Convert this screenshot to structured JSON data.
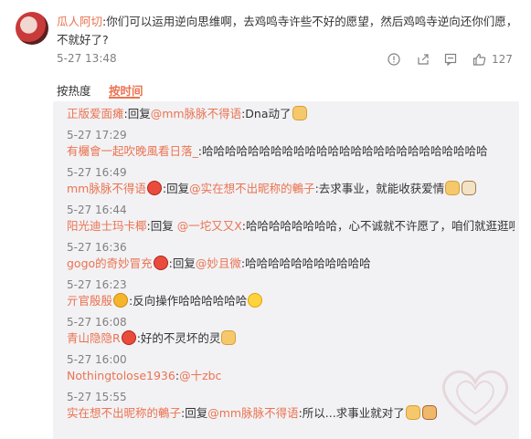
{
  "comment": {
    "username": "瓜人阿切",
    "text": ":你们可以运用逆向思维啊，去鸡鸣寺许些不好的愿望，然后鸡鸣寺逆向还你们愿，不就好了?",
    "time": "5-27 13:48",
    "like_count": "127",
    "icons": [
      "report-icon",
      "share-icon",
      "comment-icon",
      "like-icon"
    ]
  },
  "sort": {
    "hot_label": "按热度",
    "time_label": "按时间",
    "active": "time"
  },
  "replies": [
    {
      "name": "正版爱面瘫",
      "segments": [
        {
          "t": ":回复",
          "c": ""
        },
        {
          "t": "@mm脉脉不得语",
          "c": "mention"
        },
        {
          "t": ":Dna动了",
          "c": ""
        }
      ],
      "emoji_after": [
        "cat"
      ],
      "time": "5-27 17:29"
    },
    {
      "name": "有欘會一起吹晚風看日落_",
      "segments": [
        {
          "t": ":哈哈哈哈哈哈哈哈哈哈哈哈哈哈哈哈哈哈哈哈哈哈哈哈哈",
          "c": ""
        }
      ],
      "emoji_after": [],
      "time": "5-27 16:49"
    },
    {
      "name": "mm脉脉不得语",
      "name_badge": "badge",
      "segments": [
        {
          "t": ":回复",
          "c": ""
        },
        {
          "t": "@实在想不出昵称的鵪子",
          "c": "mention"
        },
        {
          "t": ":去求事业，就能收获爱情",
          "c": ""
        }
      ],
      "emoji_after": [
        "cat",
        "dog"
      ],
      "time": "5-27 16:44"
    },
    {
      "name": "阳光迪士玛卡椰",
      "segments": [
        {
          "t": ":回复 ",
          "c": ""
        },
        {
          "t": "@一坨又又X",
          "c": "mention"
        },
        {
          "t": ":哈哈哈哈哈哈哈哈，心不诚就不许愿了，咱们就逛逛呗",
          "c": ""
        }
      ],
      "emoji_after": [],
      "time": "5-27 16:36"
    },
    {
      "name": "gogo的奇妙冒充",
      "name_badge": "badge",
      "segments": [
        {
          "t": ":回复",
          "c": ""
        },
        {
          "t": "@妙且微",
          "c": "mention"
        },
        {
          "t": ":哈哈哈哈哈哈哈哈哈哈哈",
          "c": ""
        }
      ],
      "emoji_after": [],
      "time": "5-27 16:23"
    },
    {
      "name": "亓官殷殷",
      "name_badge": "v",
      "segments": [
        {
          "t": ":反向操作哈哈哈哈哈哈",
          "c": ""
        }
      ],
      "emoji_after": [
        "laugh"
      ],
      "time": "5-27 16:08"
    },
    {
      "name": "青山隐隐R",
      "name_badge": "badge",
      "segments": [
        {
          "t": ":好的不灵坏的灵",
          "c": ""
        }
      ],
      "emoji_after": [
        "cat"
      ],
      "time": "5-27 16:00"
    },
    {
      "name": "Nothingtolose1936",
      "segments": [
        {
          "t": ":",
          "c": ""
        },
        {
          "t": "@十zbc",
          "c": "mention"
        }
      ],
      "emoji_after": [],
      "time": "5-27 15:55"
    },
    {
      "name": "实在想不出昵称的鵪子",
      "segments": [
        {
          "t": ":回复",
          "c": ""
        },
        {
          "t": "@mm脉脉不得语",
          "c": "mention"
        },
        {
          "t": ":所以...求事业就对了",
          "c": ""
        }
      ],
      "emoji_after": [
        "cat",
        "cat2"
      ],
      "time": ""
    }
  ],
  "colors": {
    "accent": "#eb7350",
    "text": "#333333",
    "muted": "#808080",
    "reply_bg": "#f2f2f5"
  }
}
